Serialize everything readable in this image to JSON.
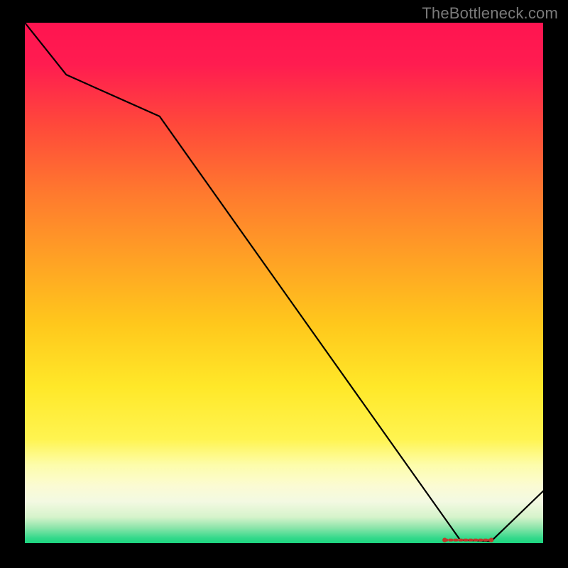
{
  "watermark": "TheBottleneck.com",
  "chart_data": {
    "type": "line",
    "x": [
      0,
      8,
      26,
      84,
      90,
      100
    ],
    "values": [
      100,
      90,
      82,
      0.6,
      0.4,
      10
    ],
    "xlabel": "",
    "ylabel": "",
    "xlim": [
      0,
      100
    ],
    "ylim": [
      0,
      100
    ],
    "title": "",
    "grid": false,
    "legend": false,
    "background_gradient": {
      "direction": "vertical",
      "stops": [
        "#ff1450",
        "#ff7a2e",
        "#ffe829",
        "#fdfdab",
        "#34d98b"
      ]
    },
    "bottom_marker": {
      "type": "dotted-segment",
      "x_range": [
        81,
        90
      ],
      "y": 0.6,
      "color": "#c0392b"
    }
  },
  "colors": {
    "line": "#000000",
    "marker": "#c0392b",
    "frame": "#000000"
  }
}
